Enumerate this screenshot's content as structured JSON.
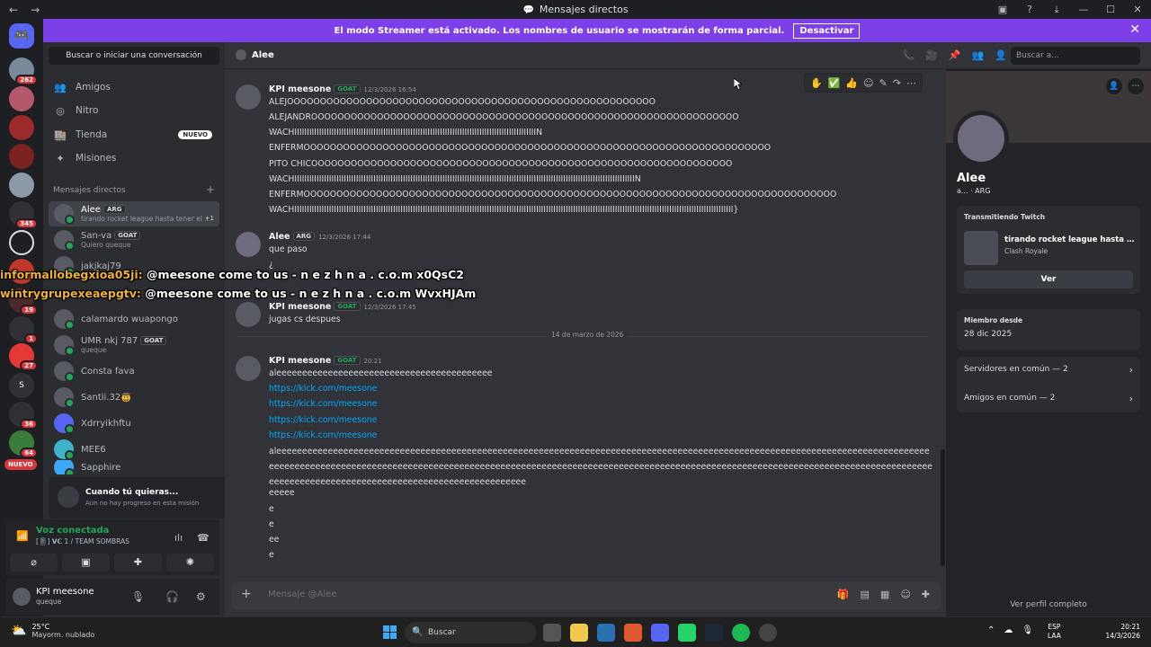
{
  "window": {
    "title": "Mensajes directos",
    "back_icon": "←",
    "forward_icon": "→",
    "controls": [
      "▣",
      "?",
      "⤓",
      "—",
      "☐",
      "✕"
    ]
  },
  "streamer_banner": {
    "text": "El modo Streamer está activado. Los nombres de usuario se mostrarán de forma parcial.",
    "button": "Desactivar",
    "close": "✕",
    "color": "#7d3fe8"
  },
  "guilds": {
    "items": [
      {
        "badge": ""
      },
      {
        "badge": "262"
      },
      {
        "badge": ""
      },
      {
        "badge": ""
      },
      {
        "badge": ""
      },
      {
        "badge": ""
      },
      {
        "badge": "345"
      },
      {
        "badge": ""
      },
      {
        "badge": ""
      },
      {
        "badge": "19"
      },
      {
        "badge": "1"
      },
      {
        "badge": "27"
      },
      {
        "badge": ""
      },
      {
        "badge": "36"
      },
      {
        "badge": "64"
      }
    ],
    "new_label": "NUEVO"
  },
  "sidebar": {
    "search_placeholder": "Buscar o iniciar una conversación",
    "nav": [
      {
        "icon": "👥",
        "label": "Amigos"
      },
      {
        "icon": "◎",
        "label": "Nitro"
      },
      {
        "icon": "🏬",
        "label": "Tienda",
        "badge": "NUEVO"
      },
      {
        "icon": "✦",
        "label": "Misiones"
      }
    ],
    "dm_header": "Mensajes directos",
    "dm_add": "+",
    "dms": [
      {
        "name": "Alee",
        "tag": "ARG",
        "status": "tirando rocket league hasta tener el ...",
        "extra": "+1"
      },
      {
        "name": "San-va",
        "tag": "GOAT",
        "status": "Quiero queque"
      },
      {
        "name": "jakjkaj79",
        "tag": "",
        "status": ""
      },
      {
        "name": "",
        "tag": "",
        "status": ""
      },
      {
        "name": "calamardo wuapongo",
        "tag": "",
        "status": ""
      },
      {
        "name": "UMR nkj 787",
        "tag": "GOAT",
        "status": "queque"
      },
      {
        "name": "Consta fava",
        "tag": "",
        "status": ""
      },
      {
        "name": "Santii.32🤠",
        "tag": "",
        "status": ""
      },
      {
        "name": "Xdrryikhftu",
        "tag": "",
        "status": ""
      },
      {
        "name": "MEE6",
        "tag": "",
        "status": ""
      },
      {
        "name": "Sapphire",
        "tag": "",
        "status": ""
      }
    ]
  },
  "quest": {
    "title": "Cuando tú quieras...",
    "subtitle": "Aún no hay progreso en esta misión"
  },
  "voice": {
    "status": "Voz conectada",
    "channel": "[🎚] 𝗩𝗖 1 / TEAM SOMBRAS"
  },
  "user": {
    "name": "KPI meesone",
    "status": "queque"
  },
  "chat": {
    "recipient": "Alee",
    "search_placeholder": "Buscar a...",
    "date_separator": "14 de marzo de 2026",
    "composer_placeholder": "Mensaje @Alee",
    "messages": [
      {
        "author": "KPI meesone",
        "tag": "GOAT",
        "time": "12/3/2026 16:54",
        "lines": [
          "ALEJOOOOOOOOOOOOOOOOOOOOOOOOOOOOOOOOOOOOOOOOOOOOOOOOOOOOOOOO",
          "ALEJANDROOOOOOOOOOOOOOOOOOOOOOOOOOOOOOOOOOOOOOOOOOOOOOOOOOOOOOOOOOOOOOOOO",
          "WACHIIIIIIIIIIIIIIIIIIIIIIIIIIIIIIIIIIIIIIIIIIIIIIIIIIIIIIIIIIIIIIIIIIIIIIIIIIIIIIIIIIIIIIIIIIIIIIIIIIN",
          "ENFERMOOOOOOOOOOOOOOOOOOOOOOOOOOOOOOOOOOOOOOOOOOOOOOOOOOOOOOOOOOOOOOOOOOOOOOO",
          "PITO CHICOOOOOOOOOOOOOOOOOOOOOOOOOOOOOOOOOOOOOOOOOOOOOOOOOOOOOOOOOOOOOOOO",
          "WACHIIIIIIIIIIIIIIIIIIIIIIIIIIIIIIIIIIIIIIIIIIIIIIIIIIIIIIIIIIIIIIIIIIIIIIIIIIIIIIIIIIIIIIIIIIIIIIIIIIIIIIIIIIIIIIIIIIIIIIIIIIIIIIIIIIIIIIIIIIN",
          "ENFERMOOOOOOOOOOOOOOOOOOOOOOOOOOOOOOOOOOOOOOOOOOOOOOOOOOOOOOOOOOOOOOOOOOOOOOOOOOOOOOOOO",
          "WACHIIIIIIIIIIIIIIIIIIIIIIIIIIIIIIIIIIIIIIIIIIIIIIIIIIIIIIIIIIIIIIIIIIIIIIIIIIIIIIIIIIIIIIIIIIIIIIIIIIIIIIIIIIIIIIIIIIIIIIIIIIIIIIIIIIIIIIIIIIIIIIIIIIIIIIIIIIIIIIIIIIIIIIIIIIIIIIIIII}"
        ]
      },
      {
        "author": "Alee",
        "tag": "ARG",
        "time": "12/3/2026 17:44",
        "lines": [
          "que paso",
          "¿"
        ]
      },
      {
        "author": "KPI meesone",
        "tag": "GOAT",
        "time": "12/3/2026 17:45",
        "lines": [
          "jugas cs despues"
        ]
      },
      {
        "author": "KPI meesone",
        "tag": "GOAT",
        "time": "20:21",
        "lines": [
          "aleeeeeeeeeeeeeeeeeeeeeeeeeeeeeeeeeeeeeeeeee"
        ],
        "links": [
          "https://kick.com/meesone",
          "https://kick.com/meesone",
          "https://kick.com/meesone",
          "https://kick.com/meesone"
        ],
        "long": "aleeeeeeeeeeeeeeeeeeeeeeeeeeeeeeeeeeeeeeeeeeeeeeeeeeeeeeeeeeeeeeeeeeeeeeeeeeeeeeeeeeeeeeeeeeeeeeeeeeeeeeeeeeeeeeeeeeeeeeeeeeeeeeeeeeeeeeeeeeeeeeeeeeeeeeeeeeeeeeeeeeeeeeeeeeeeeeeeeeeeeeeeeeeeeeeeeeeeeeeeeeeeeeeeeeeeeeeeeeeeeeeeeeeeeeeeeeeeeeeeeeeeeeeeeeeeeeeeeeeeeeeeeeeeeeeeeeeeeeeeeeeeeeeeeeeeeeeeeeeeeeeeee",
        "tail": [
          "eeeee",
          "e",
          "e",
          "ee",
          "e"
        ]
      }
    ]
  },
  "overlay": {
    "line1_user": "informallobegxioa05ji:",
    "line1_text": " @meesone come to us - n e z h n a . c.o.m x0QsC2",
    "line2_user": "wintrygrupexeaepgtv:",
    "line2_text": " @meesone come to us - n e z h n a . c.o.m WvxHJAm"
  },
  "profile": {
    "name": "Alee",
    "subtitle": "a... · ARG",
    "activity_label": "Transmitiendo Twitch",
    "activity_title": "tirando rocket league hasta tener...",
    "activity_game": "Clash Royale",
    "activity_button": "Ver",
    "member_since_label": "Miembro desde",
    "member_since": "28 dic 2025",
    "servers_common": "Servidores en común — 2",
    "friends_common": "Amigos en común — 2",
    "view_full": "Ver perfil completo"
  },
  "taskbar": {
    "temp": "25°C",
    "weather": "Mayorm. nublado",
    "search": "Buscar",
    "lang1": "ESP",
    "lang2": "LAA",
    "time": "20:21",
    "date": "14/3/2026"
  }
}
